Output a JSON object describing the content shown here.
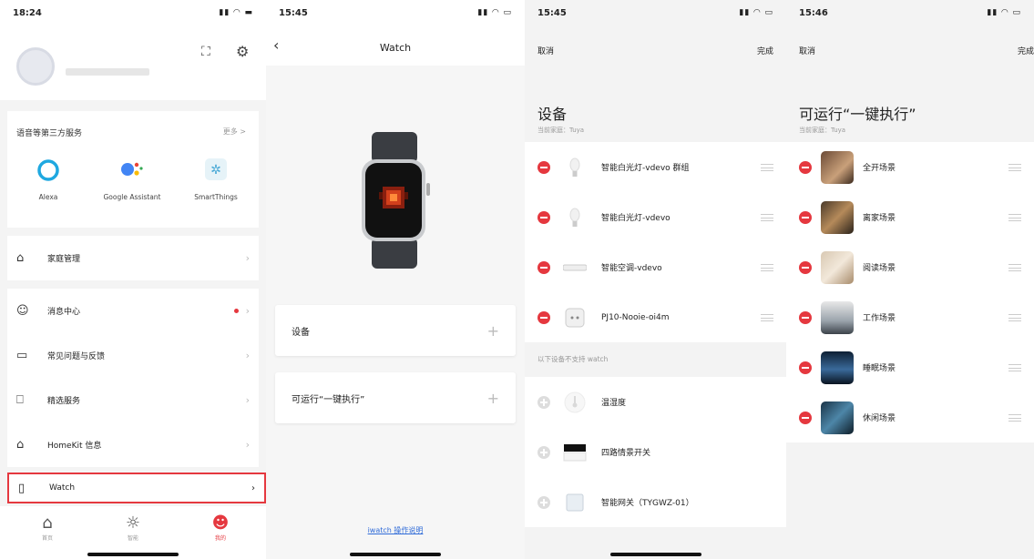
{
  "screen1": {
    "time": "18:24",
    "services": {
      "title": "语音等第三方服务",
      "more": "更多 >",
      "items": [
        {
          "label": "Alexa",
          "icon": "alexa-icon"
        },
        {
          "label": "Google Assistant",
          "icon": "google-assistant-icon"
        },
        {
          "label": "SmartThings",
          "icon": "smartthings-icon"
        }
      ]
    },
    "menu": {
      "home_mgmt": "家庭管理",
      "messages": "消息中心",
      "faq": "常见问题与反馈",
      "services": "精选服务",
      "homekit": "HomeKit 信息",
      "watch": "Watch"
    },
    "tabs": [
      {
        "label": "首页",
        "icon": "home-icon"
      },
      {
        "label": "智能",
        "icon": "sun-icon"
      },
      {
        "label": "我的",
        "icon": "me-icon"
      }
    ]
  },
  "screen2": {
    "time": "15:45",
    "title": "Watch",
    "card_devices": "设备",
    "card_scenes": "可运行“一键执行”",
    "plus": "+",
    "link": "iwatch 操作说明"
  },
  "screen3": {
    "time": "15:45",
    "cancel": "取消",
    "done": "完成",
    "title": "设备",
    "subtitle": "当前家庭：Tuya",
    "devices": [
      "智能白光灯-vdevo 群组",
      "智能白光灯-vdevo",
      "智能空调-vdevo",
      "PJ10-Nooie-oi4m"
    ],
    "unsupported_note": "以下设备不支持 watch",
    "unsupported": [
      "温湿度",
      "四路情景开关",
      "智能网关（TYGWZ-01）"
    ]
  },
  "screen4": {
    "time": "15:46",
    "cancel": "取消",
    "done": "完成",
    "title": "可运行“一键执行”",
    "subtitle": "当前家庭：Tuya",
    "scenes": [
      "全开场景",
      "离家场景",
      "阅读场景",
      "工作场景",
      "睡眠场景",
      "休闲场景"
    ]
  },
  "colors": {
    "accent_red": "#e5383f",
    "link_blue": "#2f6bd8"
  }
}
